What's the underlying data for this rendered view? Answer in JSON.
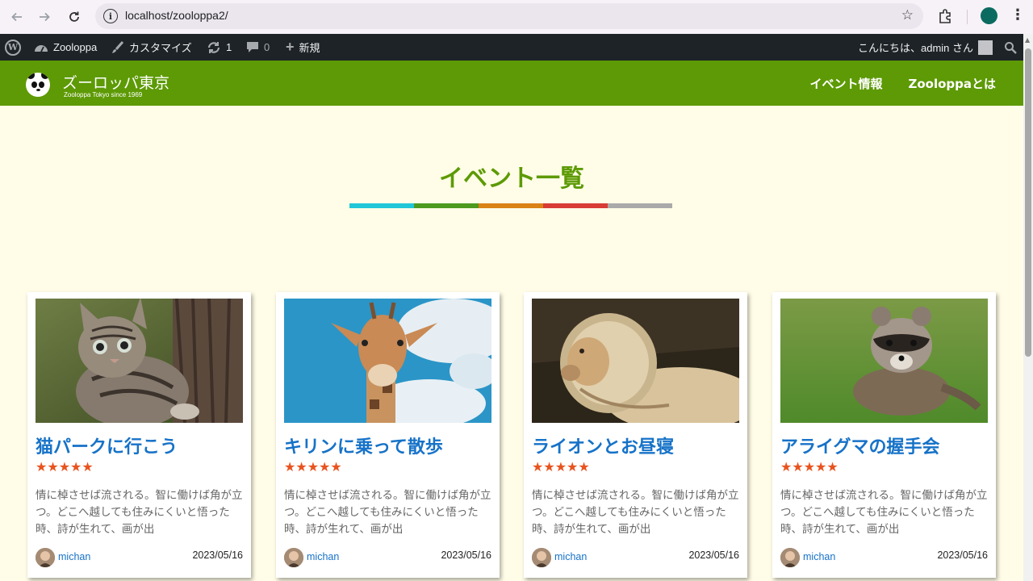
{
  "browser": {
    "url": "localhost/zooloppa2/"
  },
  "adminbar": {
    "site_name": "Zooloppa",
    "customize": "カスタマイズ",
    "updates_count": "1",
    "comments_count": "0",
    "new_label": "新規",
    "greeting": "こんにちは、admin さん"
  },
  "header": {
    "site_title": "ズーロッパ東京",
    "tagline": "Zooloppa Tokyo since 1969",
    "nav": [
      "イベント情報",
      "Zooloppaとは"
    ],
    "color": "#5d9a05"
  },
  "main": {
    "title": "イベント一覧",
    "title_bar_colors": [
      "#1fc7d8",
      "#4c9a1e",
      "#d98216",
      "#d83c35",
      "#aaaaaa"
    ]
  },
  "cards": [
    {
      "title": "猫パークに行こう",
      "stars": "★★★★★",
      "rating": 5,
      "excerpt": "情に棹させば流される。智に働けば角が立つ。どこへ越しても住みにくいと悟った時、詩が生れて、画が出",
      "author": "michan",
      "date": "2023/05/16",
      "image": "kitten-photo"
    },
    {
      "title": "キリンに乗って散歩",
      "stars": "★★★★★",
      "rating": 5,
      "excerpt": "情に棹させば流される。智に働けば角が立つ。どこへ越しても住みにくいと悟った時、詩が生れて、画が出",
      "author": "michan",
      "date": "2023/05/16",
      "image": "giraffe-photo"
    },
    {
      "title": "ライオンとお昼寝",
      "stars": "★★★★★",
      "rating": 5,
      "excerpt": "情に棹させば流される。智に働けば角が立つ。どこへ越しても住みにくいと悟った時、詩が生れて、画が出",
      "author": "michan",
      "date": "2023/05/16",
      "image": "lion-photo"
    },
    {
      "title": "アライグマの握手会",
      "stars": "★★★★★",
      "rating": 5,
      "excerpt": "情に棹させば流される。智に働けば角が立つ。どこへ越しても住みにくいと悟った時、詩が生れて、画が出",
      "author": "michan",
      "date": "2023/05/16",
      "image": "raccoon-photo"
    }
  ]
}
